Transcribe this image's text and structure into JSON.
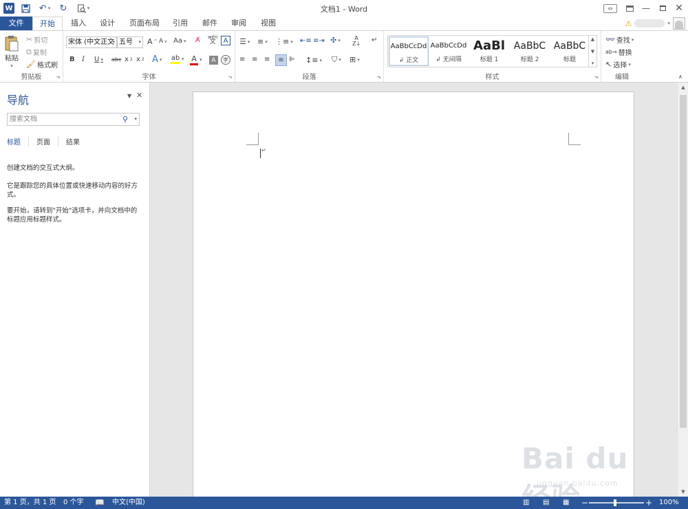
{
  "window": {
    "title": "文档1 - Word",
    "app_icon": "W"
  },
  "tabs": [
    {
      "label": "文件",
      "id": "file"
    },
    {
      "label": "开始",
      "id": "home",
      "active": true
    },
    {
      "label": "插入",
      "id": "insert"
    },
    {
      "label": "设计",
      "id": "design"
    },
    {
      "label": "页面布局",
      "id": "layout"
    },
    {
      "label": "引用",
      "id": "references"
    },
    {
      "label": "邮件",
      "id": "mailings"
    },
    {
      "label": "审阅",
      "id": "review"
    },
    {
      "label": "视图",
      "id": "view"
    }
  ],
  "ribbon": {
    "clipboard": {
      "group_label": "剪贴板",
      "paste": "粘贴",
      "cut": "剪切",
      "copy": "复制",
      "format_painter": "格式刷"
    },
    "font": {
      "group_label": "字体",
      "font_name": "宋体 (中文正文",
      "font_size": "五号"
    },
    "paragraph": {
      "group_label": "段落"
    },
    "styles": {
      "group_label": "样式",
      "items": [
        {
          "sample": "AaBbCcDd",
          "name": "正文"
        },
        {
          "sample": "AaBbCcDd",
          "name": "无间隔"
        },
        {
          "sample": "AaBl",
          "name": "标题 1"
        },
        {
          "sample": "AaBbC",
          "name": "标题 2"
        },
        {
          "sample": "AaBbC",
          "name": "标题"
        }
      ]
    },
    "editing": {
      "group_label": "编辑",
      "find": "查找",
      "replace": "替换",
      "select": "选择"
    }
  },
  "nav_pane": {
    "title": "导航",
    "search_placeholder": "搜索文档",
    "tabs": [
      "标题",
      "页面",
      "结果"
    ],
    "paragraphs": [
      "创建文档的交互式大纲。",
      "它是跟踪您的具体位置或快速移动内容的好方式。",
      "要开始，请转到\"开始\"选项卡，并向文档中的标题应用标题样式。"
    ]
  },
  "status_bar": {
    "page": "第 1 页，共 1 页",
    "words": "0 个字",
    "language": "中文(中国)",
    "zoom": "100%"
  },
  "watermark": {
    "main": "Bai du 经验",
    "sub": "jingyan.baidu.com"
  },
  "colors": {
    "accent": "#2b579a",
    "doc_bg": "#e6e6e6"
  }
}
